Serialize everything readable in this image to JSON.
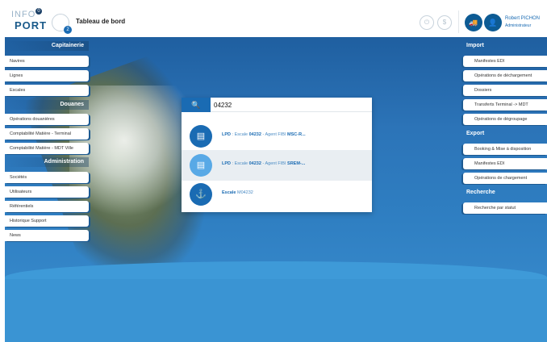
{
  "logo": {
    "line1": "INFO",
    "line2": "PORT",
    "badge": "0"
  },
  "header": {
    "title": "Tableau de bord",
    "home_badge": "2",
    "user_name": "Robert PICHON",
    "user_role": "Administrateur",
    "icons": [
      "home-icon",
      "power-icon",
      "currency-icon",
      "truck-icon",
      "user-group-icon"
    ]
  },
  "left_menu": {
    "sections": [
      {
        "title": "Capitainerie",
        "items": [
          "Navires",
          "Lignes",
          "Escales"
        ]
      },
      {
        "title": "Douanes",
        "items": [
          "Opérations douanières",
          "Comptabilité Matière - Terminal",
          "Comptabilité Matière - MDT Ville"
        ]
      },
      {
        "title": "Administration",
        "items": [
          "Sociétés",
          "Utilisateurs",
          "Référentiels",
          "Historique Support",
          "News"
        ]
      }
    ]
  },
  "right_menu": {
    "sections": [
      {
        "title": "Import",
        "items": [
          "Manifestes EDI",
          "Opérations de déchargement",
          "Dossiers",
          "Transferts Terminal -> MDT",
          "Opérations de dégroupage"
        ]
      },
      {
        "title": "Export",
        "items": [
          "Booking & Mise à disposition",
          "Manifestes EDI",
          "Opérations de chargement"
        ]
      },
      {
        "title": "Recherche",
        "items": [
          "Recherche par statut"
        ]
      }
    ]
  },
  "search": {
    "query": "04232",
    "results": [
      {
        "prefix": "LPD",
        "mid": " : Escale ",
        "code": "04232",
        "rest": " - Agent FIBI ",
        "tail": "MSC-R..."
      },
      {
        "prefix": "LPD",
        "mid": " : Escale ",
        "code": "04232",
        "rest": " - Agent FIBI ",
        "tail": "SREM-..."
      },
      {
        "prefix": "Escale",
        "mid": " M",
        "code": "04232",
        "rest": "",
        "tail": ""
      }
    ]
  },
  "colors": {
    "accent": "#1a6bb3",
    "ocean": "#2c74b8",
    "dark": "#0d5b94"
  }
}
